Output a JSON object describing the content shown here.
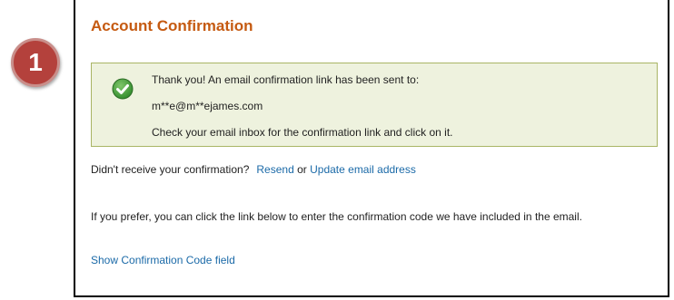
{
  "step_badge": {
    "number": "1"
  },
  "panel": {
    "title": "Account Confirmation",
    "title_color": "#c55a11"
  },
  "notice": {
    "line1": "Thank you! An email confirmation link has been sent to:",
    "email": "m**e@m**ejames.com",
    "line3": "Check your email inbox for the confirmation link and click on it.",
    "icon": "check-circle-icon",
    "background": "#eef2de",
    "border": "#a9b565"
  },
  "resend_row": {
    "prompt": "Didn't receive your confirmation?",
    "resend_link": "Resend",
    "or_text": "or",
    "update_link": "Update email address"
  },
  "prefer_text": "If you prefer, you can click the link below to enter the confirmation code we have included in the email.",
  "show_code_link": "Show Confirmation Code field",
  "link_color": "#1b6aa8"
}
